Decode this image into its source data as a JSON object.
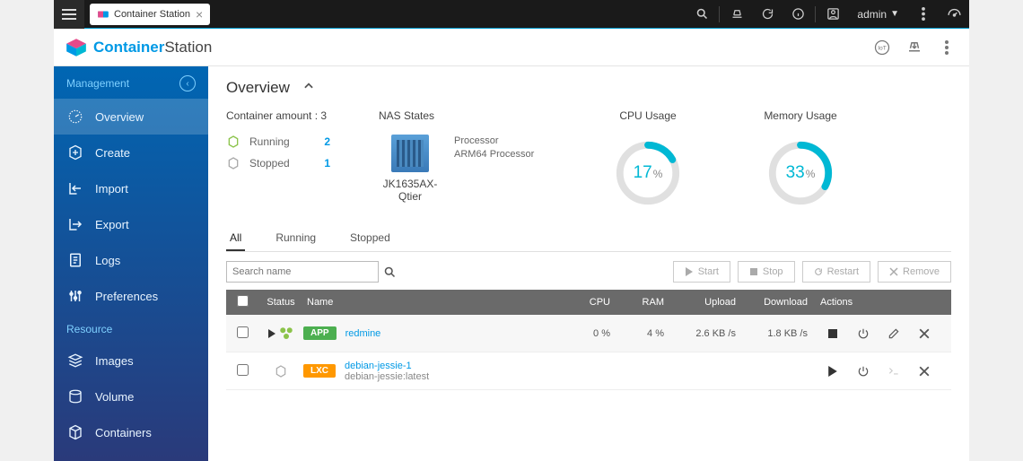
{
  "topbar": {
    "tab_title": "Container Station",
    "user": "admin"
  },
  "brand": {
    "a": "Container",
    "b": "Station"
  },
  "sidebar": {
    "section_management": "Management",
    "section_resource": "Resource",
    "items": {
      "overview": "Overview",
      "create": "Create",
      "import": "Import",
      "export": "Export",
      "logs": "Logs",
      "preferences": "Preferences",
      "images": "Images",
      "volume": "Volume",
      "containers": "Containers"
    }
  },
  "page": {
    "title": "Overview",
    "container_amount_label": "Container amount : 3",
    "running_label": "Running",
    "running_val": "2",
    "stopped_label": "Stopped",
    "stopped_val": "1",
    "nas_states_label": "NAS States",
    "nas_name": "JK1635AX-Qtier",
    "processor_label": "Processor",
    "processor_val": "ARM64 Processor",
    "cpu_usage_label": "CPU Usage",
    "cpu_pct": "17",
    "mem_usage_label": "Memory Usage",
    "mem_pct": "33"
  },
  "tabs": {
    "all": "All",
    "running": "Running",
    "stopped": "Stopped"
  },
  "search": {
    "placeholder": "Search name"
  },
  "buttons": {
    "start": "Start",
    "stop": "Stop",
    "restart": "Restart",
    "remove": "Remove"
  },
  "table": {
    "headers": {
      "status": "Status",
      "name": "Name",
      "cpu": "CPU",
      "ram": "RAM",
      "upload": "Upload",
      "download": "Download",
      "actions": "Actions"
    },
    "rows": [
      {
        "badge": "APP",
        "badge_class": "app",
        "name": "redmine",
        "sub": "",
        "cpu": "0 %",
        "ram": "4 %",
        "upload": "2.6 KB /s",
        "download": "1.8 KB /s",
        "running": true
      },
      {
        "badge": "LXC",
        "badge_class": "lxc",
        "name": "debian-jessie-1",
        "sub": "debian-jessie:latest",
        "cpu": "",
        "ram": "",
        "upload": "",
        "download": "",
        "running": false
      }
    ]
  }
}
